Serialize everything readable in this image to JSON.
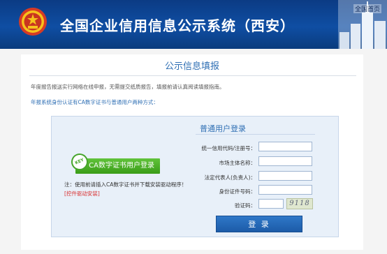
{
  "header": {
    "title": "全国企业信用信息公示系统（西安）",
    "top_link": "全国首页",
    "emblem": "national-emblem-icon",
    "skyline": "building-skyline-icon",
    "colors": {
      "header_blue": "#0f4ea3",
      "link_blue": "#2f6fb4"
    }
  },
  "content": {
    "heading": "公示信息填报",
    "notice": "年度报告报送实行网络在线申报，无需提交纸质报告，填报前请认真阅读填报指南。",
    "methods": "年报系统身份认证有CA数字证书与普通用户两种方式："
  },
  "ca": {
    "badge": "KEY",
    "button": "CA数字证书用户登录",
    "note": "注：使用前请插入CA数字证书并下载安装驱动程序！",
    "note_link": "[控件驱动安装]"
  },
  "login": {
    "title": "普通用户登录",
    "fields": [
      {
        "label": "统一信用代码/注册号：",
        "value": ""
      },
      {
        "label": "市场主体名称：",
        "value": ""
      },
      {
        "label": "法定代表人(负责人)：",
        "value": ""
      },
      {
        "label": "身份证件号码：",
        "value": ""
      },
      {
        "label": "验证码：",
        "value": ""
      }
    ],
    "captcha_text": "9118",
    "button": "登 录",
    "colors": {
      "button_blue": "#2a6fbd",
      "ca_green": "#46a52b"
    }
  }
}
